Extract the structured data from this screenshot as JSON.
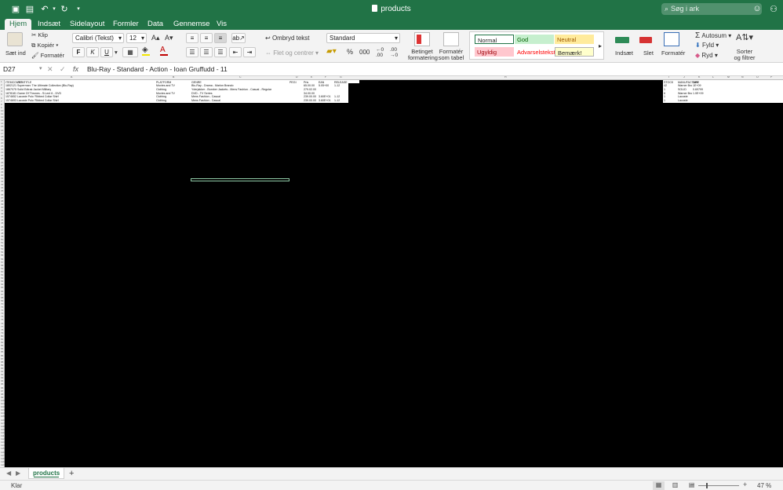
{
  "window": {
    "title": "products",
    "search_placeholder": "Søg i ark"
  },
  "tabs": [
    "Hjem",
    "Indsæt",
    "Sidelayout",
    "Formler",
    "Data",
    "Gennemse",
    "Vis"
  ],
  "ribbon": {
    "paste_label": "Sæt ind",
    "cut_label": "Klip",
    "copy_label": "Kopiér",
    "format_painter_label": "Formatér",
    "font_name": "Calibri (Tekst)",
    "font_size": "12",
    "bold": "F",
    "italic": "K",
    "underline": "U",
    "wrap_text_label": "Ombryd tekst",
    "merge_label": "Flet og centrer",
    "number_format": "Standard",
    "percent": "%",
    "thousands": "000",
    "conditional_formatting": "Betinget formatering",
    "format_as_table": "Formatér som tabel",
    "styles": {
      "normal": "Normal",
      "good": "God",
      "neutral": "Neutral",
      "bad": "Ugyldig",
      "warning": "Advarselstekst",
      "note": "Bemærk!"
    },
    "insert_label": "Indsæt",
    "delete_label": "Slet",
    "format_label": "Formatér",
    "autosum_label": "Autosum",
    "fill_label": "Fyld",
    "clear_label": "Ryd",
    "sort_filter_label": "Sorter og filtrer"
  },
  "formula_bar": {
    "name_box": "D27",
    "formula": "Blu-Ray - Standard - Action - Ioan Gruffudd - 11"
  },
  "sheet": {
    "columns": [
      "A",
      "B",
      "C",
      "D",
      "E",
      "F",
      "G",
      "H",
      "I",
      "J",
      "K",
      "L",
      "M",
      "N",
      "O",
      "P",
      "Q"
    ],
    "headers": {
      "a": "ITEMCOUNT",
      "b": "ITEMTITLE",
      "c": "PLATFORM",
      "d": "GENRE",
      "e": "PEGI",
      "f": "Pris",
      "g": "EAN",
      "h": "RELEASE",
      "i": "IMAGE",
      "stock": "STOCK",
      "manu": "MANUFACTURE",
      "dim": "DIM"
    },
    "rows": [
      {
        "a": "1802121",
        "b": "Superman: The Ultimate Collection (Blu-Ray)",
        "c": "Movies and TV",
        "d": "Blu-Ray - Drama - Marlon Brando",
        "f": "65.00.00",
        "g": "5.05+00",
        "h": "1-12",
        "stock": "42",
        "manu": "Warner Bro",
        "dim": "1E+09"
      },
      {
        "a": "1867075",
        "b": "Solid Edtrak Jacket Military",
        "c": "Clothing",
        "d": "Yderjakker - Bomber Jackets - Mens Fashion - Casual - Regular",
        "f": "279.02.00",
        "g": "",
        "h": "",
        "stock": "1",
        "manu": "SOLID",
        "dim": "0.69799"
      },
      {
        "a": "1878181",
        "b": "Game Of Thrones - S:Lent 6 - DVD",
        "c": "Movies and TV",
        "d": "DVD - TV Series",
        "f": "34.00.00",
        "g": "",
        "h": "",
        "stock": "6",
        "manu": "Warner Bro",
        "dim": "1.0E+09"
      },
      {
        "a": "1574652",
        "b": "Lacoste Polo 'Ribbed Collar Shirt'",
        "c": "Clothing",
        "d": "Mens Fashion - Casual",
        "f": "239.00.00",
        "g": "3.60E+01",
        "h": "1-12",
        "stock": "1",
        "manu": "Lacoste",
        "dim": ""
      },
      {
        "a": "1574693",
        "b": "Lacoste Polo 'Ribbed Collar Shirt'",
        "c": "Clothing",
        "d": "Mens Fashion - Casual",
        "f": "239.00.00",
        "g": "3.60E+01",
        "h": "1-12",
        "stock": "1",
        "manu": "Lacoste",
        "dim": ""
      }
    ]
  },
  "sheet_tabs": [
    "products"
  ],
  "status": {
    "ready": "Klar",
    "zoom": "47 %"
  }
}
